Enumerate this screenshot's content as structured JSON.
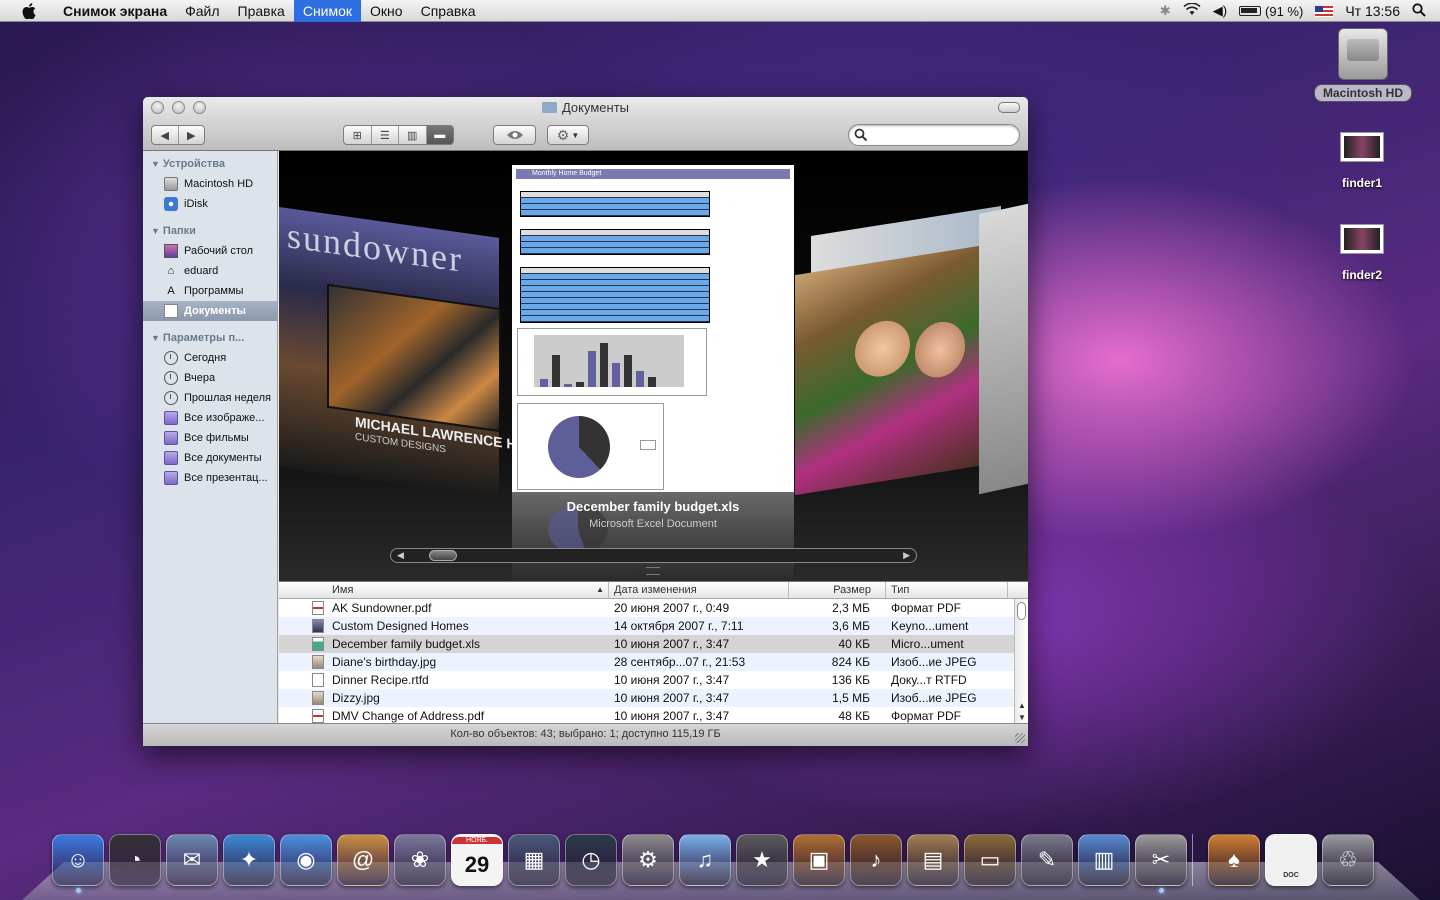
{
  "menubar": {
    "app_name": "Снимок экрана",
    "items": [
      "Файл",
      "Правка",
      "Снимок",
      "Окно",
      "Справка"
    ],
    "active_item": "Снимок",
    "battery": "(91 %)",
    "clock": "Чт 13:56"
  },
  "desktop": {
    "icons": [
      {
        "label": "Macintosh HD",
        "icon": "hard-drive-icon"
      },
      {
        "label": "finder1",
        "icon": "screenshot-file-icon"
      },
      {
        "label": "finder2",
        "icon": "screenshot-file-icon"
      }
    ]
  },
  "window": {
    "title": "Документы",
    "view_modes": [
      "icon-view",
      "list-view",
      "column-view",
      "coverflow-view"
    ],
    "active_view": "coverflow-view",
    "search_placeholder": "",
    "status": "Кол-во объектов: 43; выбрано: 1; доступно 115,19 ГБ"
  },
  "sidebar": {
    "sections": [
      {
        "title": "Устройства",
        "items": [
          {
            "label": "Macintosh HD",
            "icon": "disk-icon"
          },
          {
            "label": "iDisk",
            "icon": "idisk-icon"
          }
        ]
      },
      {
        "title": "Папки",
        "items": [
          {
            "label": "Рабочий стол",
            "icon": "desktop-icon"
          },
          {
            "label": "eduard",
            "icon": "home-icon"
          },
          {
            "label": "Программы",
            "icon": "applications-icon"
          },
          {
            "label": "Документы",
            "icon": "documents-icon",
            "selected": true
          }
        ]
      },
      {
        "title": "Параметры п...",
        "items": [
          {
            "label": "Сегодня",
            "icon": "clock-icon"
          },
          {
            "label": "Вчера",
            "icon": "clock-icon"
          },
          {
            "label": "Прошлая неделя",
            "icon": "clock-icon"
          },
          {
            "label": "Все изображе...",
            "icon": "smart-folder-icon"
          },
          {
            "label": "Все фильмы",
            "icon": "smart-folder-icon"
          },
          {
            "label": "Все документы",
            "icon": "smart-folder-icon"
          },
          {
            "label": "Все презентац...",
            "icon": "smart-folder-icon"
          }
        ]
      }
    ]
  },
  "coverflow": {
    "left_cover_brand": "sundowner",
    "left_cover_name": "MICHAEL LAWRENCE HOMES",
    "left_cover_sub": "CUSTOM DESIGNS",
    "center_sheet_title": "Monthly Home Budget",
    "selected_name": "December family budget.xls",
    "selected_kind": "Microsoft Excel Document"
  },
  "list": {
    "columns": [
      "Имя",
      "Дата изменения",
      "Размер",
      "Тип"
    ],
    "sort_column": "Имя",
    "rows": [
      {
        "name": "AK Sundowner.pdf",
        "date": "20 июня 2007 г., 0:49",
        "size": "2,3 МБ",
        "kind": "Формат PDF",
        "icon": "pdf"
      },
      {
        "name": "Custom Designed Homes",
        "date": "14 октября 2007 г., 7:11",
        "size": "3,6 МБ",
        "kind": "Keyno...ument",
        "icon": "key"
      },
      {
        "name": "December family budget.xls",
        "date": "10 июня 2007 г., 3:47",
        "size": "40 КБ",
        "kind": "Micro...ument",
        "icon": "xls",
        "selected": true
      },
      {
        "name": "Diane's birthday.jpg",
        "date": "28 сентябр...07 г., 21:53",
        "size": "824 КБ",
        "kind": "Изоб...ие JPEG",
        "icon": "jpg"
      },
      {
        "name": "Dinner Recipe.rtfd",
        "date": "10 июня 2007 г., 3:47",
        "size": "136 КБ",
        "kind": "Доку...т RTFD",
        "icon": "doc"
      },
      {
        "name": "Dizzy.jpg",
        "date": "10 июня 2007 г., 3:47",
        "size": "1,5 МБ",
        "kind": "Изоб...ие JPEG",
        "icon": "jpg"
      },
      {
        "name": "DMV Change of Address.pdf",
        "date": "10 июня 2007 г., 3:47",
        "size": "48 КБ",
        "kind": "Формат PDF",
        "icon": "pdf"
      }
    ]
  },
  "dock": {
    "items": [
      {
        "name": "finder-icon",
        "color": "#3a7be0",
        "glyph": "☺",
        "running": true
      },
      {
        "name": "dashboard-icon",
        "color": "#333333",
        "glyph": "◔"
      },
      {
        "name": "mail-icon",
        "color": "#6a8ab0",
        "glyph": "✉"
      },
      {
        "name": "safari-icon",
        "color": "#3a8ad0",
        "glyph": "✦"
      },
      {
        "name": "ichat-icon",
        "color": "#4a90e0",
        "glyph": "◉"
      },
      {
        "name": "address-book-icon",
        "color": "#c89040",
        "glyph": "@"
      },
      {
        "name": "iphoto-camera-icon",
        "color": "#7a7a9a",
        "glyph": "❀"
      },
      {
        "name": "ical-icon",
        "color": "#f4f4f4",
        "glyph": "29",
        "sub": "НОЯБ."
      },
      {
        "name": "spaces-icon",
        "color": "#4a5a7a",
        "glyph": "▦"
      },
      {
        "name": "time-machine-icon",
        "color": "#2a3a4a",
        "glyph": "◷"
      },
      {
        "name": "system-preferences-icon",
        "color": "#8a8a8a",
        "glyph": "⚙"
      },
      {
        "name": "itunes-icon",
        "color": "#7ab0e8",
        "glyph": "♫"
      },
      {
        "name": "imovie-icon",
        "color": "#5a5a5a",
        "glyph": "★"
      },
      {
        "name": "iphoto-icon",
        "color": "#b07030",
        "glyph": "▣"
      },
      {
        "name": "garageband-icon",
        "color": "#8a5a2a",
        "glyph": "♪"
      },
      {
        "name": "iweb-icon",
        "color": "#a08050",
        "glyph": "▤"
      },
      {
        "name": "keynote-icon",
        "color": "#8a6a3a",
        "glyph": "▭"
      },
      {
        "name": "script-editor-icon",
        "color": "#7a7a8a",
        "glyph": "✎"
      },
      {
        "name": "numbers-chart-icon",
        "color": "#5a8ad0",
        "glyph": "▥"
      },
      {
        "name": "grab-icon",
        "color": "#9a9a9a",
        "glyph": "✂",
        "running": true
      },
      {
        "separator": true
      },
      {
        "name": "applications-stack-icon",
        "color": "#d08030",
        "glyph": "♠"
      },
      {
        "name": "documents-stack-icon",
        "color": "#f0f0f0",
        "glyph": "",
        "sub": "DOC"
      },
      {
        "name": "trash-icon",
        "color": "#9a9aa0",
        "glyph": "♲"
      }
    ]
  }
}
